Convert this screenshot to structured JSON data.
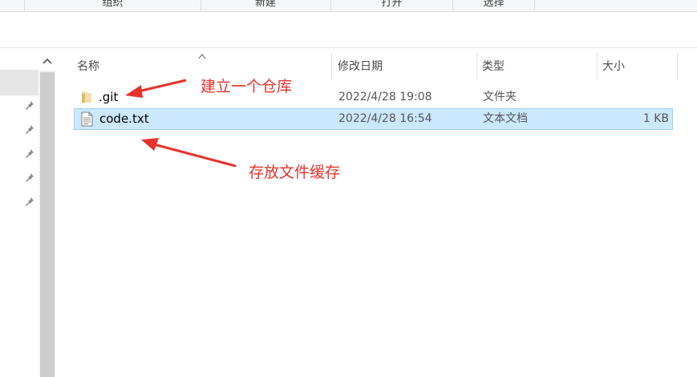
{
  "ribbon": {
    "groups": [
      "组织",
      "新建",
      "打开",
      "选择"
    ]
  },
  "columns": {
    "name": "名称",
    "date": "修改日期",
    "type": "类型",
    "size": "大小"
  },
  "files": [
    {
      "name": ".git",
      "date": "2022/4/28 19:08",
      "type": "文件夹",
      "size": "",
      "icon": "folder-icon",
      "selected": false
    },
    {
      "name": "code.txt",
      "date": "2022/4/28 16:54",
      "type": "文本文档",
      "size": "1 KB",
      "icon": "text-file-icon",
      "selected": true
    }
  ],
  "annotations": [
    {
      "text": "建立一个仓库"
    },
    {
      "text": "存放文件缓存"
    }
  ],
  "colors": {
    "selection_bg": "#cce8ff",
    "selection_border": "#99d1ff",
    "annotation": "#e8322b",
    "folder": "#e8c16a"
  }
}
